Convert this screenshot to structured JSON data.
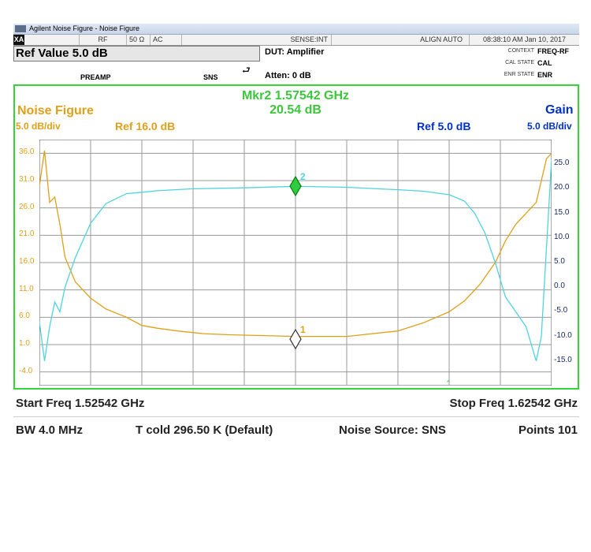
{
  "window": {
    "title": "Agilent Noise Figure - Noise Figure"
  },
  "status_bar": {
    "mode_icon": "XA",
    "rf": "RF",
    "impedance": "50 Ω",
    "coupling": "AC",
    "sense": "SENSE:INT",
    "align": "ALIGN AUTO",
    "timestamp": "08:38:10 AM Jan 10, 2017"
  },
  "settings": {
    "ref_value": "Ref Value 5.0 dB",
    "dut": "DUT: Amplifier",
    "atten": "Atten: 0 dB",
    "preamp": "PREAMP",
    "sns": "SNS",
    "context_label": "CONTEXT",
    "context_value": "FREQ-RF",
    "cal_state_label": "CAL STATE",
    "cal_state_value": "CAL",
    "enr_state_label": "ENR STATE",
    "enr_state_value": "ENR"
  },
  "marker": {
    "label": "Mkr2  1.57542 GHz",
    "value": "20.54 dB"
  },
  "left_trace": {
    "name": "Noise Figure",
    "scale": "5.0 dB/div",
    "ref": "Ref 16.0 dB",
    "color": "#e0a01a"
  },
  "right_trace": {
    "name": "Gain",
    "scale": "5.0 dB/div",
    "ref": "Ref 5.0 dB",
    "color": "#4fd4dc"
  },
  "footer": {
    "start_freq": "Start Freq 1.52542 GHz",
    "stop_freq": "Stop Freq 1.62542 GHz",
    "bw": "BW 4.0 MHz",
    "tcold": "T cold 296.50 K (Default)",
    "noise_source": "Noise Source: SNS",
    "points": "Points 101"
  },
  "chart_data": {
    "type": "line",
    "x_range": [
      1.52542,
      1.62542
    ],
    "x_unit": "GHz",
    "left_axis": {
      "ticks": [
        "36.0",
        "31.0",
        "26.0",
        "21.0",
        "16.0",
        "11.0",
        "6.0",
        "1.0",
        "-4.0"
      ],
      "ylim": [
        -6.5,
        38.5
      ]
    },
    "right_axis": {
      "ticks": [
        "25.0",
        "20.0",
        "15.0",
        "10.0",
        "5.0",
        "0.0",
        "-5.0",
        "-10.0",
        "-15.0"
      ],
      "ylim": [
        -20,
        30
      ]
    },
    "series": [
      {
        "name": "Noise Figure",
        "axis": "left",
        "color": "#e0a01a",
        "x": [
          1.52542,
          1.52642,
          1.52742,
          1.52842,
          1.52942,
          1.53042,
          1.53242,
          1.53542,
          1.53842,
          1.54242,
          1.54542,
          1.54842,
          1.55242,
          1.55742,
          1.56242,
          1.57542,
          1.58542,
          1.59542,
          1.60042,
          1.60542,
          1.60842,
          1.61142,
          1.61442,
          1.61642,
          1.61842,
          1.62042,
          1.62242,
          1.62442,
          1.62542
        ],
        "values": [
          30,
          36.5,
          27,
          28,
          23,
          17,
          12.5,
          9.5,
          7.5,
          6,
          4.5,
          4,
          3.5,
          3,
          2.8,
          2.5,
          2.5,
          3.5,
          5,
          7,
          9,
          12,
          16,
          20,
          23,
          25,
          27,
          35,
          36
        ]
      },
      {
        "name": "Gain",
        "axis": "right",
        "color": "#4fd4dc",
        "x": [
          1.52542,
          1.52642,
          1.52742,
          1.52842,
          1.52942,
          1.53042,
          1.53242,
          1.53542,
          1.53842,
          1.54242,
          1.54542,
          1.54842,
          1.55542,
          1.56542,
          1.57542,
          1.58542,
          1.59542,
          1.60042,
          1.60542,
          1.60842,
          1.61042,
          1.61242,
          1.61442,
          1.61642,
          1.61842,
          1.62042,
          1.62242,
          1.62342,
          1.62542
        ],
        "values": [
          -7,
          -15,
          -8,
          -3,
          -5,
          0,
          6,
          13,
          17,
          19,
          19.3,
          19.6,
          20,
          20.2,
          20.5,
          20.3,
          19.8,
          19.5,
          18.8,
          17.5,
          15,
          11,
          5,
          -2,
          -5,
          -8,
          -15,
          -10,
          26
        ]
      }
    ],
    "markers": [
      {
        "id": "1",
        "trace": "Noise Figure",
        "x": 1.57542,
        "y": 2.0
      },
      {
        "id": "2",
        "trace": "Gain",
        "x": 1.57542,
        "y": 20.54
      }
    ],
    "grid": true
  }
}
